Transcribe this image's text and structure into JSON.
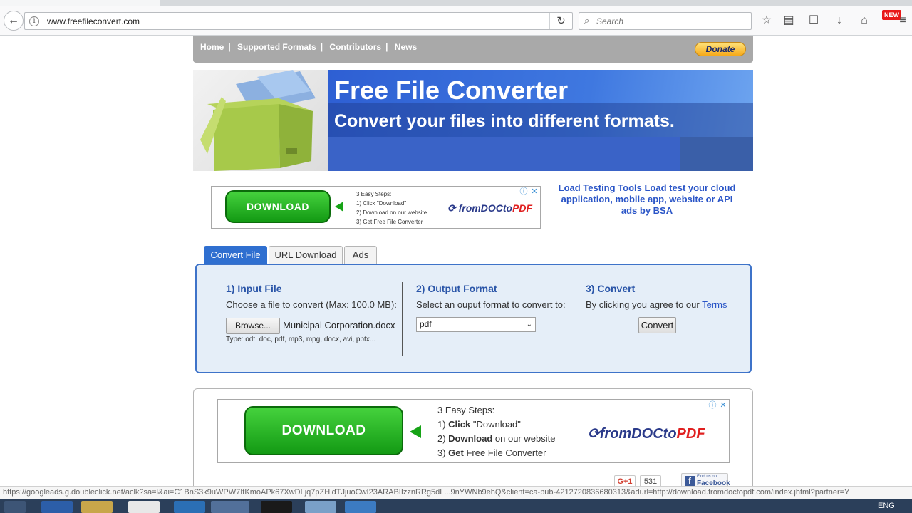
{
  "browser": {
    "url": "www.freefileconvert.com",
    "search_placeholder": "Search",
    "new_badge": "NEW",
    "status_url": "https://googleads.g.doubleclick.net/aclk?sa=l&ai=C1BnS3k9uWPW7ItKmoAPk67XwDLjq7pZHldTJjuoCwI23ARABIIzznRRg5dL...9nYWNb9ehQ&client=ca-pub-4212720836680313&adurl=http://download.fromdoctopdf.com/index.jhtml?partner=Y"
  },
  "site_nav": {
    "items": [
      "Home",
      "Supported Formats",
      "Contributors",
      "News"
    ],
    "donate_label": "Donate"
  },
  "banner": {
    "title": "Free File Converter",
    "subtitle": "Convert your files into different formats."
  },
  "ad_top": {
    "download_label": "DOWNLOAD",
    "steps_heading": "3 Easy Steps:",
    "step1": "1) Click \"Download\"",
    "step2": "2) Download on our website",
    "step3": "3) Get Free File Converter",
    "brand_prefix": "fromDOCto",
    "brand_suffix": "PDF"
  },
  "bsa_ad": {
    "line1": "Load Testing Tools Load test your cloud application, mobile app, website or API",
    "line2": "ads by BSA"
  },
  "tabs": [
    {
      "label": "Convert File",
      "active": true
    },
    {
      "label": "URL Download",
      "active": false
    },
    {
      "label": "Ads",
      "active": false
    }
  ],
  "convert_panel": {
    "input": {
      "title": "1) Input File",
      "desc": "Choose a file to convert (Max: 100.0 MB):",
      "browse_label": "Browse...",
      "file_name": "Municipal Corporation.docx",
      "types": "Type: odt, doc, pdf, mp3, mpg, docx, avi, pptx..."
    },
    "output": {
      "title": "2) Output Format",
      "desc": "Select an ouput format to convert to:",
      "selected_format": "pdf"
    },
    "convert": {
      "title": "3) Convert",
      "desc": "By clicking you agree to our",
      "terms_label": "Terms",
      "button_label": "Convert"
    }
  },
  "ad_bottom": {
    "download_label": "DOWNLOAD",
    "steps_heading": "3 Easy Steps:",
    "step1_bold": "Click",
    "step1_rest": " \"Download\"",
    "step2_bold": "Download",
    "step2_rest": " on our website",
    "step3_bold": "Get",
    "step3_rest": " Free File Converter",
    "brand_prefix": "fromDOCto",
    "brand_suffix": "PDF"
  },
  "social": {
    "gplus_label": "G+1",
    "gplus_count": "531",
    "fb_small": "Find us on",
    "fb_label": "Facebook"
  },
  "taskbar": {
    "language": "ENG"
  }
}
